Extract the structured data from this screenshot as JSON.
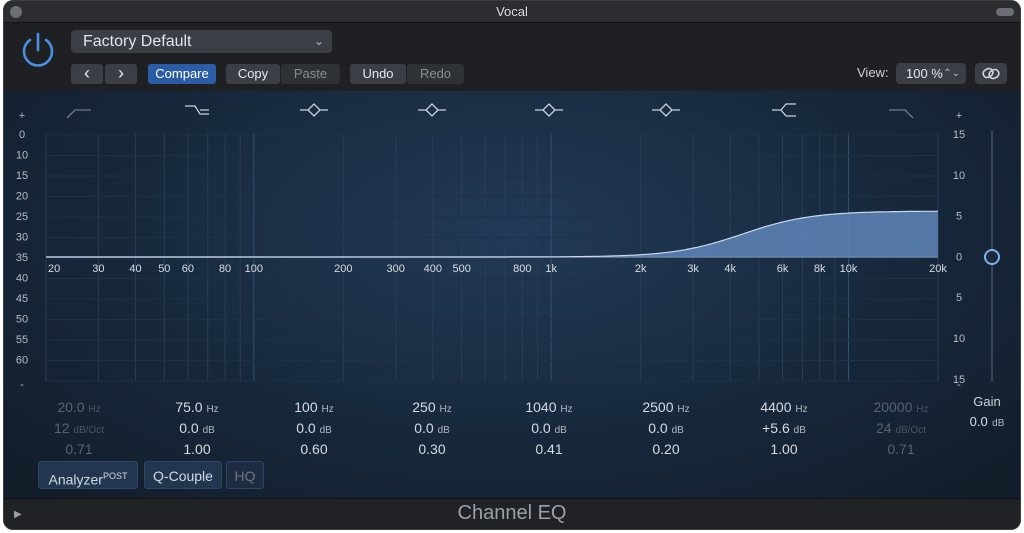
{
  "window": {
    "title": "Vocal"
  },
  "header": {
    "preset": "Factory Default",
    "prev_glyph": "‹",
    "next_glyph": "›",
    "compare": "Compare",
    "copy": "Copy",
    "paste": "Paste",
    "undo": "Undo",
    "redo": "Redo",
    "view_label": "View:",
    "zoom": "100 %"
  },
  "graph": {
    "db_labels_left": [
      "+",
      "0",
      "10",
      "15",
      "20",
      "25",
      "30",
      "35",
      "40",
      "45",
      "50",
      "55",
      "60",
      "-"
    ],
    "db_labels_right": [
      "+",
      "15",
      "10",
      "5",
      "0",
      "5",
      "10",
      "15",
      "-"
    ],
    "freq_labels": [
      "20",
      "30",
      "40",
      "50",
      "60",
      "80",
      "100",
      "200",
      "300",
      "400",
      "500",
      "800",
      "1k",
      "2k",
      "3k",
      "4k",
      "6k",
      "8k",
      "10k",
      "20k"
    ],
    "freq_values": [
      20,
      30,
      40,
      50,
      60,
      80,
      100,
      200,
      300,
      400,
      500,
      800,
      1000,
      2000,
      3000,
      4000,
      6000,
      8000,
      10000,
      20000
    ],
    "band_icons": [
      "low-cut-icon",
      "low-shelf-icon",
      "bell-icon",
      "bell-icon",
      "bell-icon",
      "bell-icon",
      "high-shelf-icon",
      "high-cut-icon"
    ],
    "curve": {
      "type": "high-shelf",
      "freq_hz": 4400,
      "gain_db": 5.6,
      "q": 1.0
    }
  },
  "bands": [
    {
      "freq": "20.0",
      "freq_unit": "Hz",
      "gain": "12",
      "gain_unit": "dB/Oct",
      "q": "0.71",
      "active": false
    },
    {
      "freq": "75.0",
      "freq_unit": "Hz",
      "gain": "0.0",
      "gain_unit": "dB",
      "q": "1.00",
      "active": true
    },
    {
      "freq": "100",
      "freq_unit": "Hz",
      "gain": "0.0",
      "gain_unit": "dB",
      "q": "0.60",
      "active": true
    },
    {
      "freq": "250",
      "freq_unit": "Hz",
      "gain": "0.0",
      "gain_unit": "dB",
      "q": "0.30",
      "active": true
    },
    {
      "freq": "1040",
      "freq_unit": "Hz",
      "gain": "0.0",
      "gain_unit": "dB",
      "q": "0.41",
      "active": true
    },
    {
      "freq": "2500",
      "freq_unit": "Hz",
      "gain": "0.0",
      "gain_unit": "dB",
      "q": "0.20",
      "active": true
    },
    {
      "freq": "4400",
      "freq_unit": "Hz",
      "gain": "+5.6",
      "gain_unit": "dB",
      "q": "1.00",
      "active": true
    },
    {
      "freq": "20000",
      "freq_unit": "Hz",
      "gain": "24",
      "gain_unit": "dB/Oct",
      "q": "0.71",
      "active": false
    }
  ],
  "gain": {
    "label": "Gain",
    "value": "0.0",
    "unit": "dB",
    "value_db": 0.0
  },
  "lower": {
    "analyzer": "Analyzer",
    "analyzer_sup": "POST",
    "q_couple": "Q-Couple",
    "hq": "HQ"
  },
  "footer": {
    "title": "Channel EQ"
  },
  "colors": {
    "accent": "#4a90e2",
    "curve_fill": "#5f86b8",
    "compare_bg": "#2b5da6"
  }
}
